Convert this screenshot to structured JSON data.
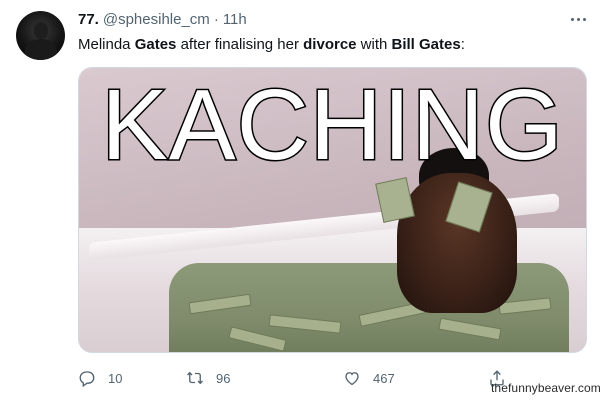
{
  "tweet": {
    "display_name": "77.",
    "handle": "@sphesihle_cm",
    "separator": "·",
    "time": "11h",
    "text": {
      "part1": "Melinda ",
      "bold1": "Gates",
      "part2": " after finalising her ",
      "bold2": "divorce",
      "part3": " with ",
      "bold3": "Bill Gates",
      "part4": ":"
    },
    "media": {
      "overlay_text": "KACHING"
    },
    "stats": {
      "replies": "10",
      "retweets": "96",
      "likes": "467"
    }
  },
  "icons": {
    "avatar": "avatar-image",
    "more": "more-dots-icon",
    "reply": "reply-icon",
    "retweet": "retweet-icon",
    "like": "heart-icon",
    "share": "share-icon"
  },
  "watermark": "thefunnybeaver.com",
  "colors": {
    "text_primary": "#0f1419",
    "text_secondary": "#536471",
    "border": "#cfd9de"
  }
}
